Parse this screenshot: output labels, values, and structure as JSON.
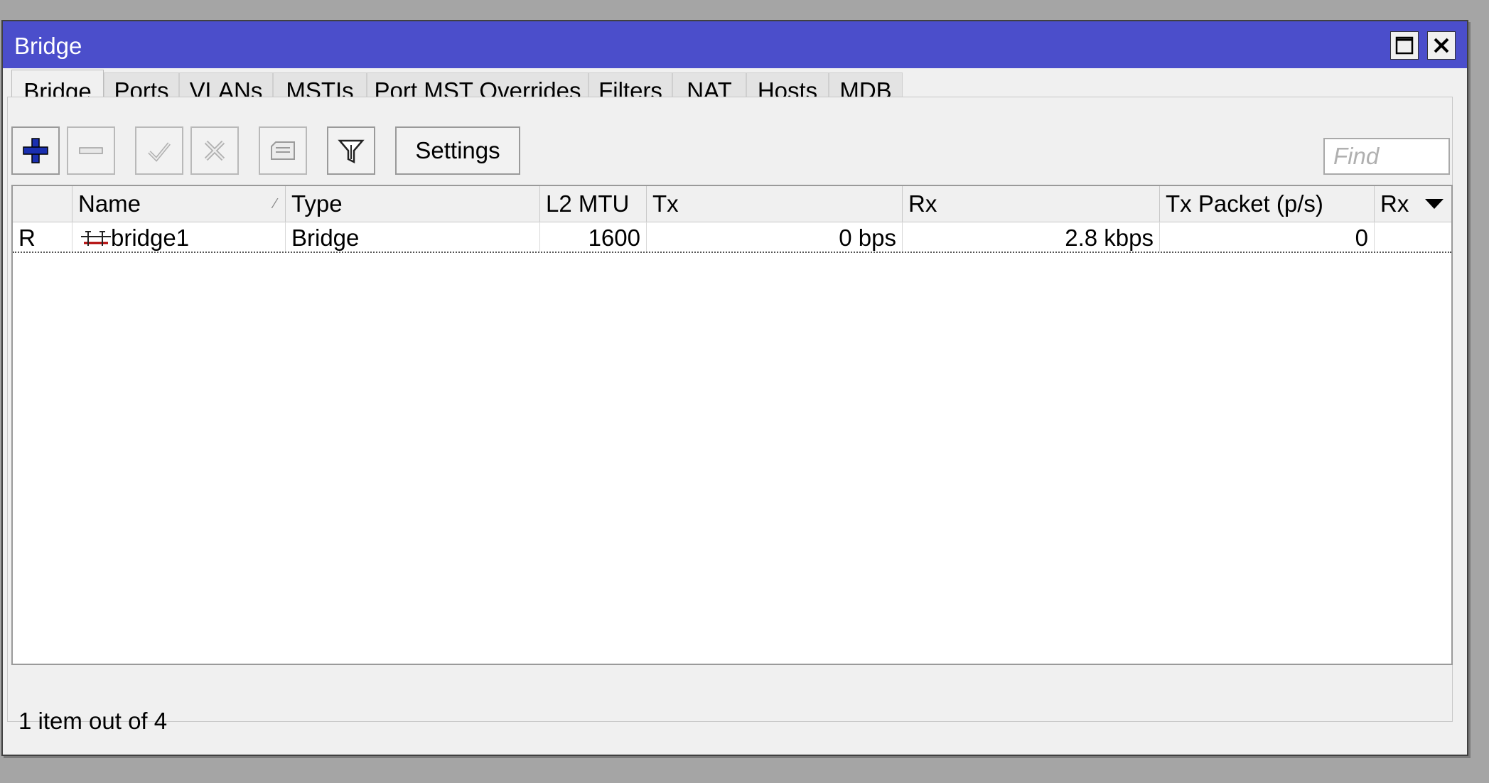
{
  "window": {
    "title": "Bridge",
    "titlebar_color": "#4b4ecb",
    "controls": [
      "maximize-icon",
      "close-icon"
    ]
  },
  "tabs": [
    {
      "label": "Bridge",
      "active": true
    },
    {
      "label": "Ports"
    },
    {
      "label": "VLANs"
    },
    {
      "label": "MSTIs"
    },
    {
      "label": "Port MST Overrides"
    },
    {
      "label": "Filters"
    },
    {
      "label": "NAT"
    },
    {
      "label": "Hosts"
    },
    {
      "label": "MDB"
    }
  ],
  "toolbar": {
    "buttons": [
      {
        "icon": "plus-icon",
        "enabled": true
      },
      {
        "icon": "minus-icon",
        "enabled": false
      },
      {
        "icon": "check-icon",
        "enabled": false
      },
      {
        "icon": "cross-icon",
        "enabled": false
      },
      {
        "icon": "comment-icon",
        "enabled": false
      },
      {
        "icon": "filter-icon",
        "enabled": true
      }
    ],
    "settings_label": "Settings",
    "find_placeholder": "Find"
  },
  "table": {
    "columns": [
      "",
      "Name",
      "Type",
      "L2 MTU",
      "Tx",
      "Rx",
      "Tx Packet (p/s)",
      "Rx P"
    ],
    "sorted_column": "Name",
    "rows": [
      {
        "flag": "R",
        "icon": "bridge-icon",
        "name": "bridge1",
        "type": "Bridge",
        "l2mtu": "1600",
        "tx": "0 bps",
        "rx": "2.8 kbps",
        "tx_packet": "0",
        "rx_packet": ""
      }
    ]
  },
  "status": {
    "text": "1 item out of 4"
  }
}
